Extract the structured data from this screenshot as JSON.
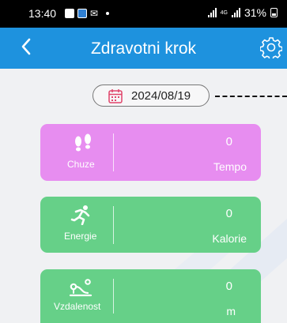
{
  "status_bar": {
    "time": "13:40",
    "battery": "31%",
    "network": "4G"
  },
  "header": {
    "title": "Zdravotni krok"
  },
  "date_selector": {
    "date": "2024/08/19"
  },
  "cards": [
    {
      "label": "Chuze",
      "value": "0",
      "unit": "Tempo",
      "icon": "footsteps-icon",
      "color": "#e78df0"
    },
    {
      "label": "Energie",
      "value": "0",
      "unit": "Kalorie",
      "icon": "running-person-icon",
      "color": "#66d088"
    },
    {
      "label": "Vzdalenost",
      "value": "0",
      "unit": "m",
      "icon": "distance-icon",
      "color": "#66d088"
    }
  ],
  "colors": {
    "app_bar": "#1e92de",
    "background": "#f0f1f3"
  }
}
